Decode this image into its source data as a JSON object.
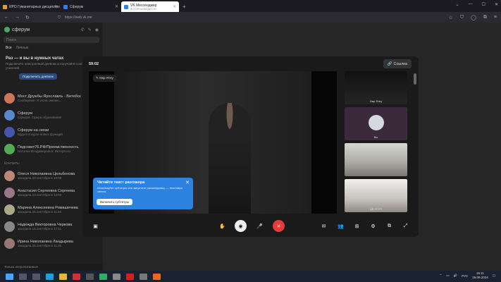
{
  "browser": {
    "tabs": [
      {
        "label": "ИРО Гуманитарных дисциплин",
        "color": "#e0a030"
      },
      {
        "label": "Сферум",
        "color": "#2f7df6"
      },
      {
        "label": "VK Мессенджер",
        "sub": "ВОСПРОИЗВОДИТСЯ",
        "color": "#2f7df6"
      }
    ],
    "new_tab": "+",
    "url": "https://web.vk.me"
  },
  "sidebar": {
    "brand": "сферум",
    "search_placeholder": "Поиск",
    "filters": [
      "Все",
      "Личные"
    ],
    "promo": {
      "title": "Раз — и вы в нужных чатах",
      "desc": "Подключите электронный дневник и получайте сообщения от учителей",
      "button": "Подключить дневник"
    },
    "chats": [
      {
        "name": "Мост Дружбы Ярославль - Витебск",
        "sub": "Сообщение: Я очень желаю...",
        "color": "#c75"
      },
      {
        "name": "Сферум",
        "sub": "Сферум: Сфера образования",
        "color": "#58c"
      },
      {
        "name": "Сферум на связи",
        "sub": "Будьте в курсе новых функций",
        "color": "#45a"
      },
      {
        "name": "Педсовет76.РФ/Преемственность",
        "sub": "Наталья Владимировна: Интересно",
        "color": "#5a5"
      }
    ],
    "contacts_title": "Контакты",
    "contacts": [
      {
        "name": "Олеся Николаевна Цельбенова",
        "sub": "заходила 20 сентября в 10:08",
        "color": "#b87"
      },
      {
        "name": "Анастасия Сергеевна Сергеева",
        "sub": "заходила 23 сентября в 13:00",
        "color": "#978"
      },
      {
        "name": "Марина Алексеевна Ромашечева",
        "sub": "заходила 25 сентября в 11:46",
        "color": "#aa8"
      },
      {
        "name": "Надежда Викторовна Черкова",
        "sub": "заходила 16 сентября в 17:11",
        "color": "#888"
      },
      {
        "name": "Ирина Николаевна Ландырева",
        "sub": "заходила 26 сентября в 11:35",
        "color": "#977"
      }
    ],
    "bottom_hint": "Только непрочитанные"
  },
  "call": {
    "timer": "59:02",
    "link_label": "Ссылка",
    "speaker_name": "Овр Ятпу",
    "tip": {
      "title": "Читайте текст разговора",
      "desc": "Используйте субтитры или запустите расшифровку — текстовую запись",
      "button": "Включить субтитры"
    },
    "participants": [
      {
        "label": "Овр Ятпу"
      },
      {
        "label": "Вы"
      },
      {
        "label": ""
      },
      {
        "label": "ЦВ ЯГУП"
      },
      {
        "label": ""
      }
    ]
  },
  "taskbar": {
    "lang": "РУС",
    "time": "15:11",
    "date": "26.09.2024"
  },
  "colors": {
    "accent": "#2d81e0",
    "end_call": "#e23c3c"
  }
}
